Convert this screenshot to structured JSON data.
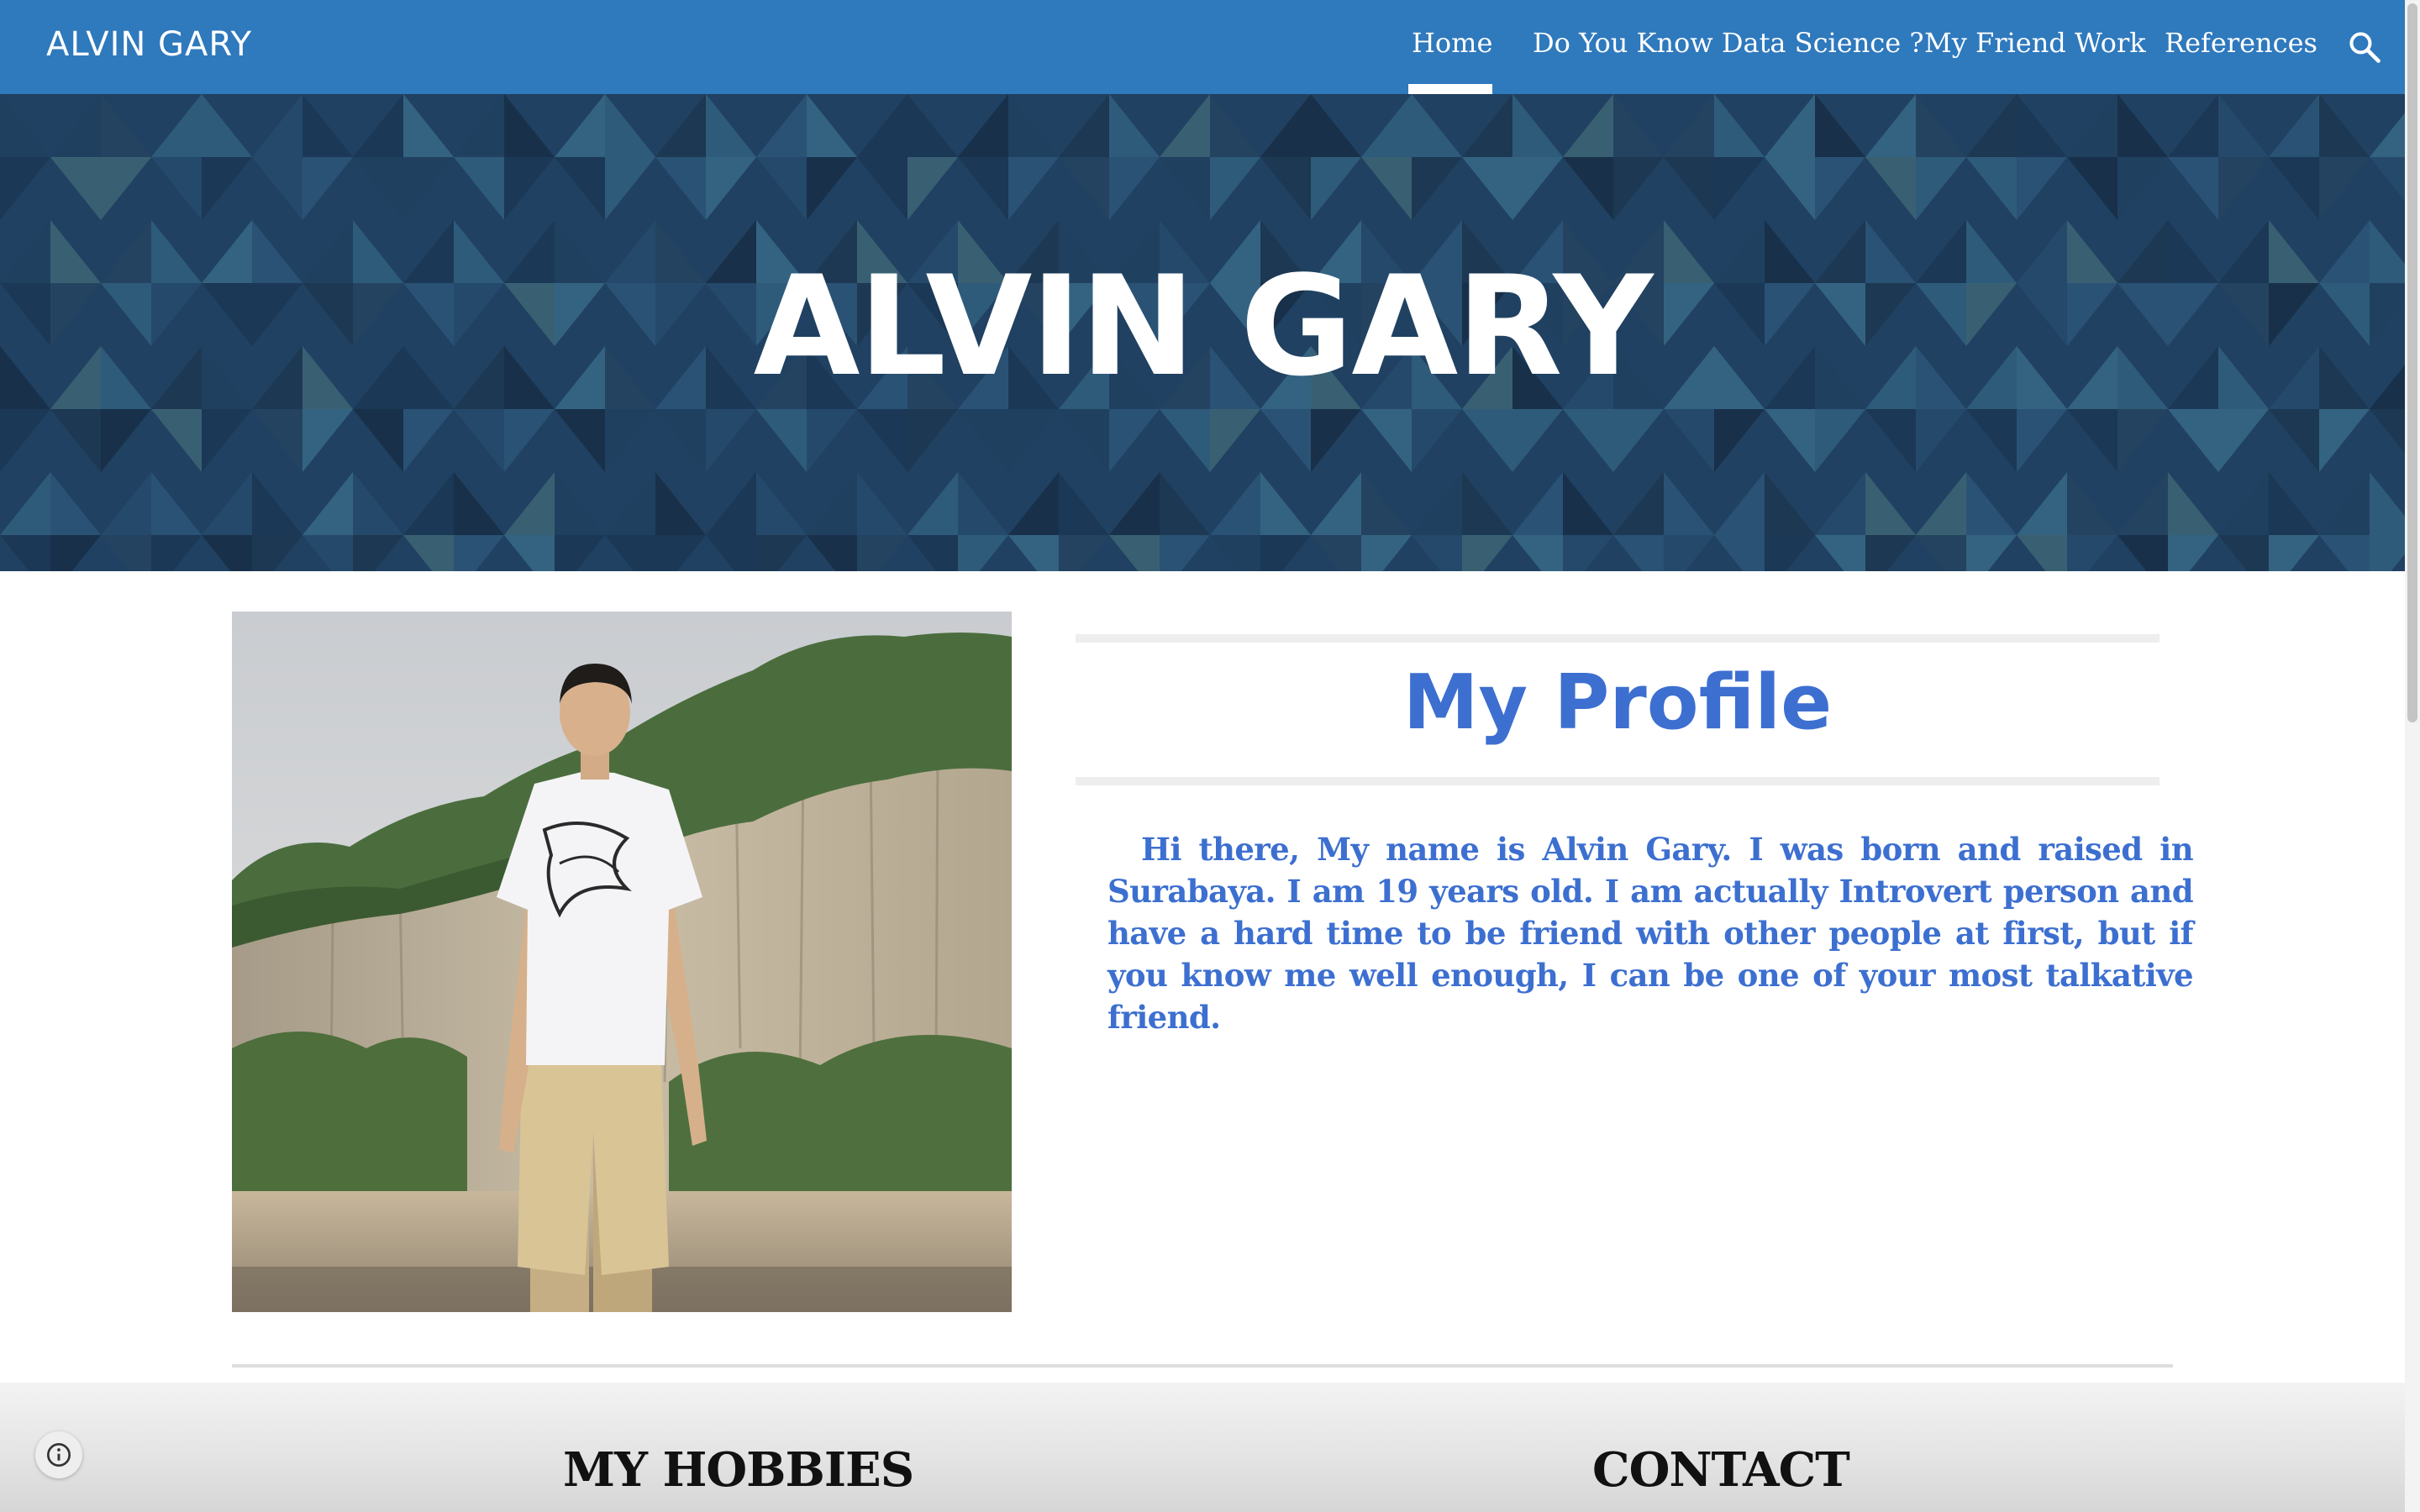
{
  "header": {
    "site_title": "ALVIN GARY",
    "nav": [
      {
        "label": "Home",
        "active": true
      },
      {
        "label": "Do You Know Data Science ?",
        "active": false
      },
      {
        "label": "My Friend Work",
        "active": false
      },
      {
        "label": "References",
        "active": false
      }
    ],
    "search_icon": "search-icon",
    "background_color": "#2f79bd"
  },
  "hero": {
    "title": "ALVIN GARY"
  },
  "profile": {
    "heading": "My Profile",
    "text": "Hi there, My name is Alvin Gary. I was born and raised in Surabaya. I am 19 years old. I am actually Introvert person and have a hard time to be friend with other people at first, but if you know me well enough, I can be one of your most talkative friend.",
    "accent_color": "#3c6fd0"
  },
  "footer": {
    "hobbies_heading": "MY HOBBIES",
    "contact_heading": "CONTACT",
    "info_icon": "info-icon"
  }
}
